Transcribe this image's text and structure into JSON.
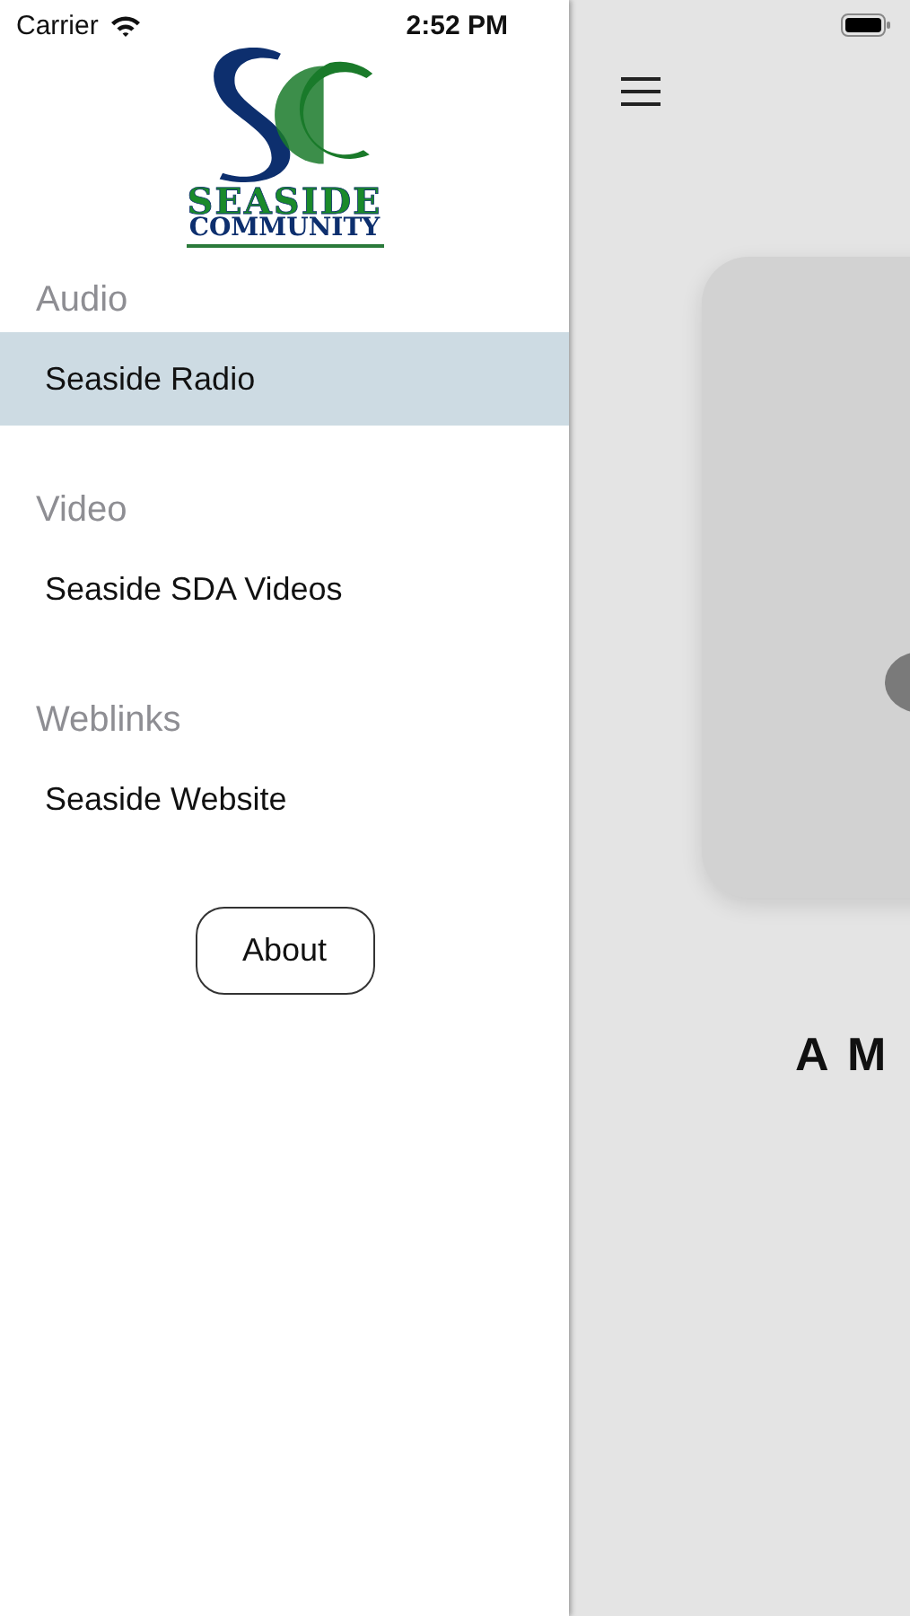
{
  "status_bar": {
    "carrier": "Carrier",
    "time": "2:52 PM"
  },
  "logo": {
    "name": "SEASIDE",
    "subtitle": "COMMUNITY"
  },
  "sections": [
    {
      "title": "Audio",
      "items": [
        {
          "label": "Seaside Radio",
          "selected": true
        }
      ]
    },
    {
      "title": "Video",
      "items": [
        {
          "label": "Seaside SDA Videos",
          "selected": false
        }
      ]
    },
    {
      "title": "Weblinks",
      "items": [
        {
          "label": "Seaside Website",
          "selected": false
        }
      ]
    }
  ],
  "about_button": "About",
  "main": {
    "title": "A M"
  }
}
